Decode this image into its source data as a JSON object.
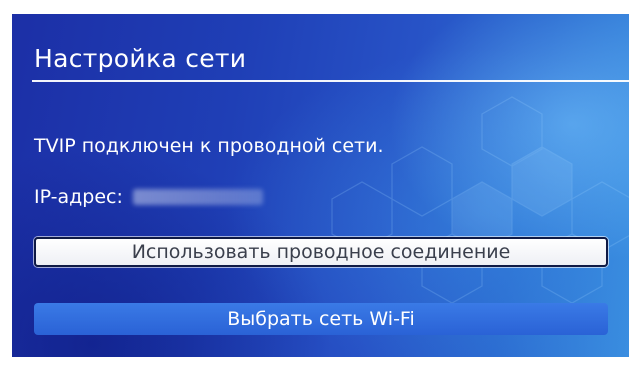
{
  "screen": {
    "title": "Настройка сети",
    "status_text": "TVIP подключен к проводной сети.",
    "ip_label": "IP-адрес:",
    "ip_value": "**.**.**.***"
  },
  "buttons": {
    "wired_label": "Использовать проводное соединение",
    "wifi_label": "Выбрать сеть Wi-Fi"
  },
  "colors": {
    "background_blue": "#1f3fb6",
    "accent_light_blue": "#3a8ee0",
    "selected_button_bg": "#ffffff",
    "wifi_button_bg": "#2a62d6",
    "text": "#ffffff"
  }
}
